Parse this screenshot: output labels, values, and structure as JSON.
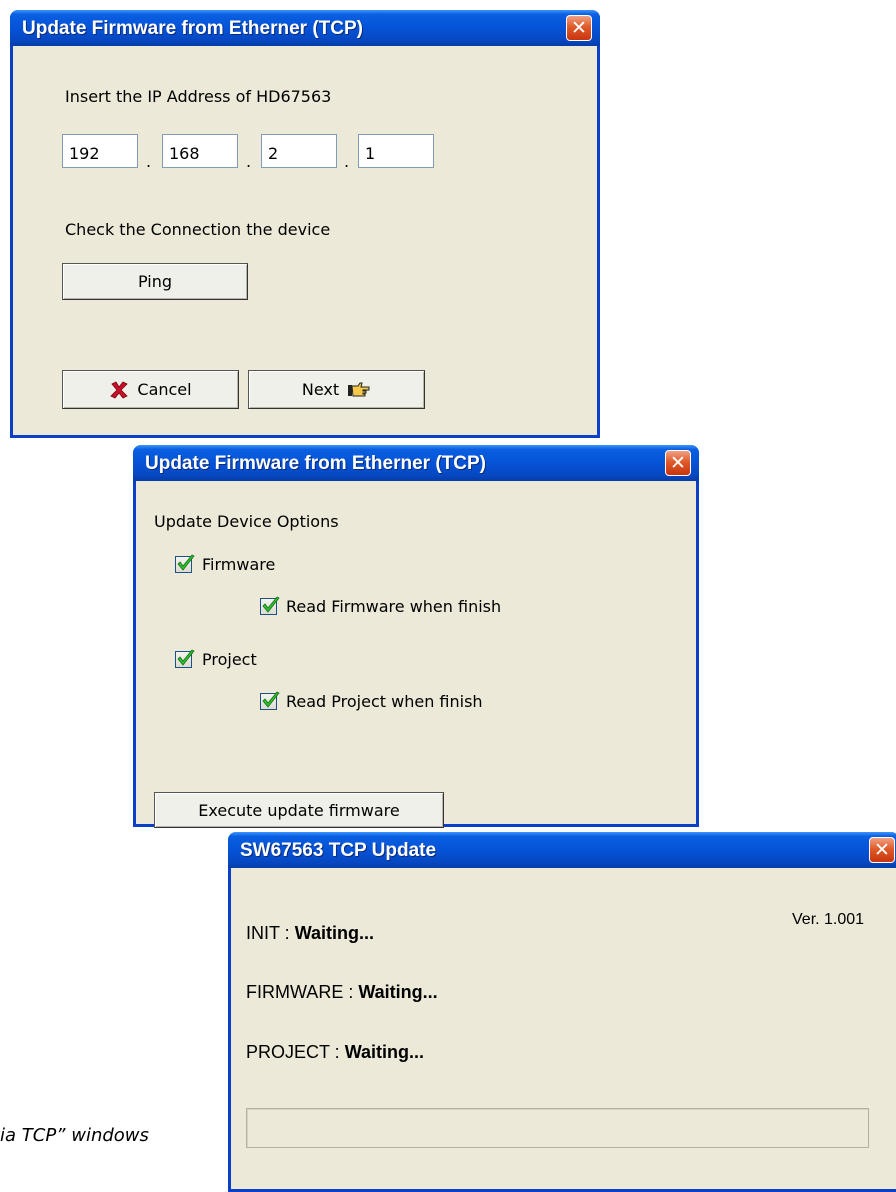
{
  "window1": {
    "title": "Update Firmware from Etherner (TCP)",
    "close_glyph": "✕",
    "prompt": "Insert the IP Address of HD67563",
    "ip": [
      "192",
      "168",
      "2",
      "1"
    ],
    "separator": ".",
    "check_label": "Check the Connection the device",
    "ping_label": "Ping",
    "cancel_label": "Cancel",
    "next_label": "Next",
    "icons": {
      "cancel": "red-x-icon",
      "next": "pointing-hand-icon"
    }
  },
  "window2": {
    "title": "Update Firmware from Etherner (TCP)",
    "close_glyph": "✕",
    "options_label": "Update Device Options",
    "options": [
      {
        "label": "Firmware",
        "checked": true
      },
      {
        "label": "Read Firmware when finish",
        "checked": true
      },
      {
        "label": "Project",
        "checked": true
      },
      {
        "label": "Read Project when finish",
        "checked": true
      }
    ],
    "execute_label": "Execute update firmware"
  },
  "window3": {
    "title": "SW67563 TCP Update",
    "close_glyph": "✕",
    "version": "Ver. 1.001",
    "init_label": "INIT : ",
    "init_status": "Waiting...",
    "firmware_label": "FIRMWARE : ",
    "firmware_status": "Waiting...",
    "project_label": "PROJECT : ",
    "project_status": "Waiting...",
    "progress": 0
  },
  "caption": "ia TCP” windows",
  "colors": {
    "titlebar": "#0553d8",
    "window_bg": "#ece9d8",
    "close_button": "#e05a2a",
    "check": "#2fbf2f"
  }
}
